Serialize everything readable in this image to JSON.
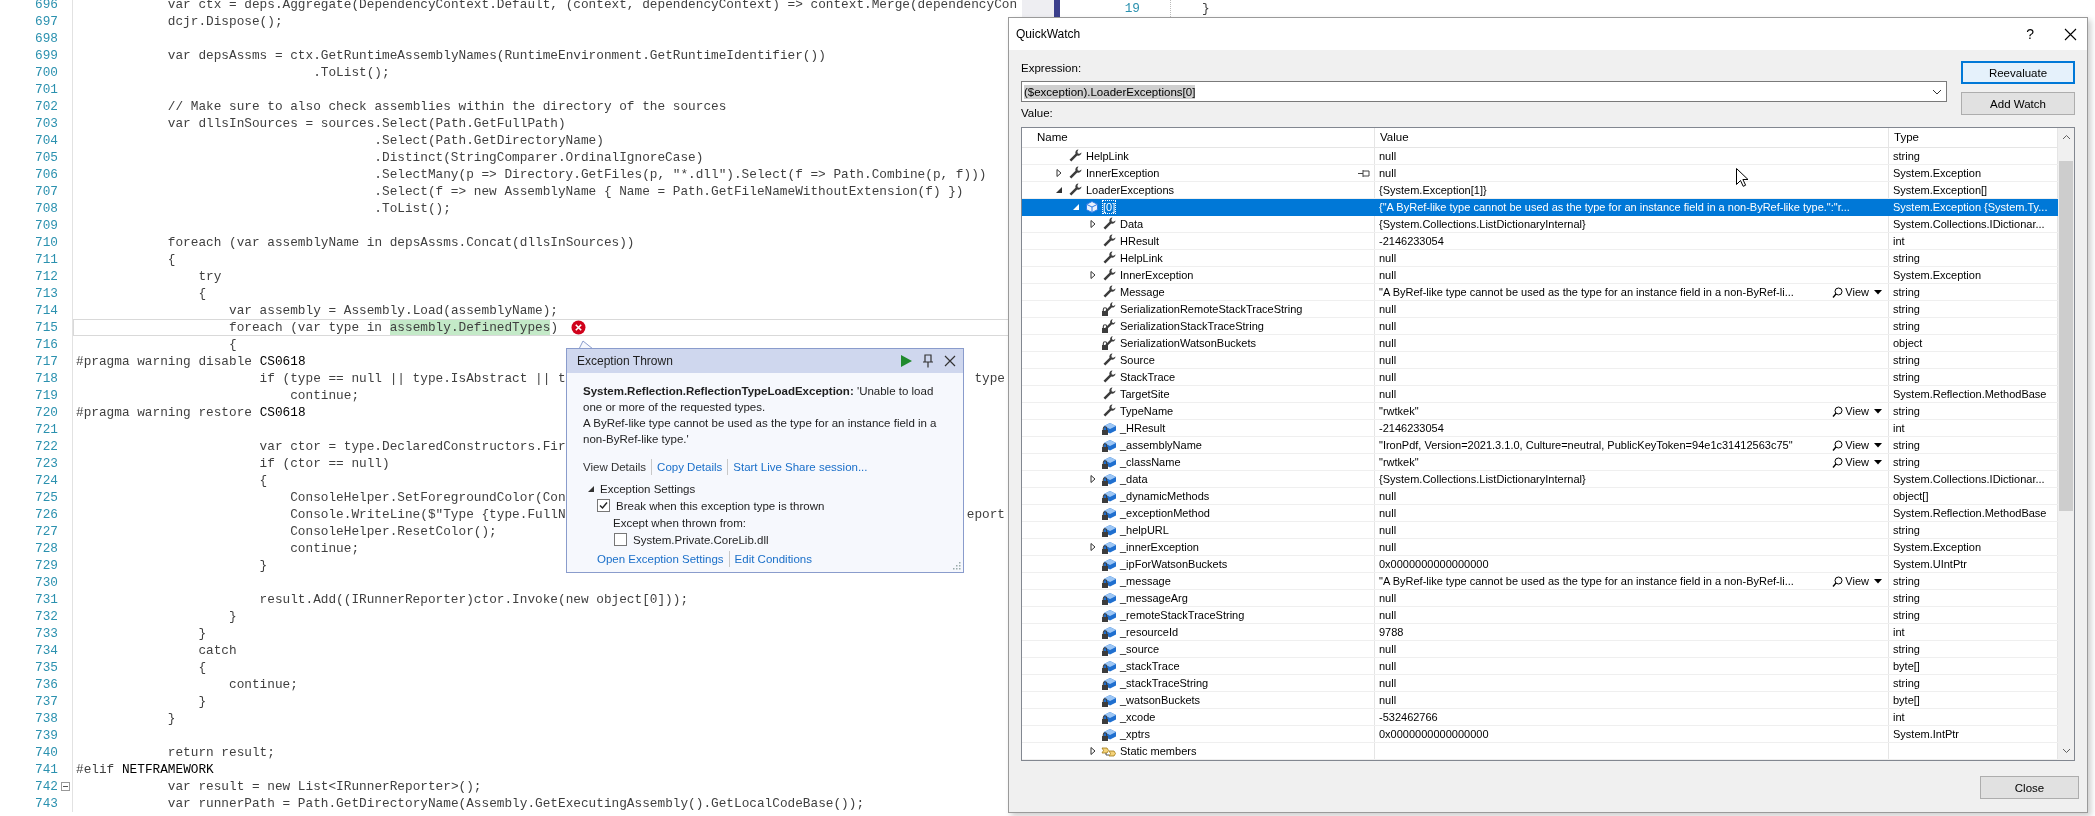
{
  "editor": {
    "lines": [
      {
        "number": "696",
        "text": "            var ctx = deps.Aggregate(DependencyContext.Default, (context, dependencyContext) => context.Merge(dependencyCon"
      },
      {
        "number": "697",
        "text": "            dcjr.Dispose();"
      },
      {
        "number": "698"
      },
      {
        "number": "699",
        "text": "            var depsAssms = ctx.GetRuntimeAssemblyNames(RuntimeEnvironment.GetRuntimeIdentifier())"
      },
      {
        "number": "700",
        "text": "                               .ToList();"
      },
      {
        "number": "701"
      },
      {
        "number": "702",
        "text": "            // Make sure to also check assemblies within the directory of the sources"
      },
      {
        "number": "703",
        "text": "            var dllsInSources = sources.Select(Path.GetFullPath)"
      },
      {
        "number": "704",
        "text": "                                       .Select(Path.GetDirectoryName)"
      },
      {
        "number": "705",
        "text": "                                       .Distinct(StringComparer.OrdinalIgnoreCase)"
      },
      {
        "number": "706",
        "text": "                                       .SelectMany(p => Directory.GetFiles(p, \"*.dll\").Select(f => Path.Combine(p, f)))"
      },
      {
        "number": "707",
        "text": "                                       .Select(f => new AssemblyName { Name = Path.GetFileNameWithoutExtension(f) })"
      },
      {
        "number": "708",
        "text": "                                       .ToList();"
      },
      {
        "number": "709"
      },
      {
        "number": "710",
        "text": "            foreach (var assemblyName in depsAssms.Concat(dllsInSources))"
      },
      {
        "number": "711",
        "text": "            {"
      },
      {
        "number": "712",
        "text": "                try"
      },
      {
        "number": "713",
        "text": "                {"
      },
      {
        "number": "714",
        "text": "                    var assembly = Assembly.Load(assemblyName);"
      },
      {
        "number": "715",
        "text": "                    foreach (var type in ",
        "highlight": "assembly.DefinedTypes",
        "after": ")",
        "error": true,
        "current": true
      },
      {
        "number": "716",
        "text": "                    {"
      },
      {
        "number": "717",
        "text": "#pragma warning disable ",
        "symbol": "CS0618"
      },
      {
        "number": "718",
        "text": "                        if (type == null || type.IsAbstract || t",
        "tail": "type"
      },
      {
        "number": "719",
        "text": "                            continue;"
      },
      {
        "number": "720",
        "text": "#pragma warning restore ",
        "symbol": "CS0618"
      },
      {
        "number": "721"
      },
      {
        "number": "722",
        "text": "                        var ctor = type.DeclaredConstructors.Fir"
      },
      {
        "number": "723",
        "text": "                        if (ctor == null)"
      },
      {
        "number": "724",
        "text": "                        {"
      },
      {
        "number": "725",
        "text": "                            ConsoleHelper.SetForegroundColor(Con"
      },
      {
        "number": "726",
        "text": "                            Console.WriteLine($\"Type {type.FullN",
        "tail": "eport"
      },
      {
        "number": "727",
        "text": "                            ConsoleHelper.ResetColor();"
      },
      {
        "number": "728",
        "text": "                            continue;"
      },
      {
        "number": "729",
        "text": "                        }"
      },
      {
        "number": "730"
      },
      {
        "number": "731",
        "text": "                        result.Add((IRunnerReporter)ctor.Invoke(new object[0]));"
      },
      {
        "number": "732",
        "text": "                    }"
      },
      {
        "number": "733",
        "text": "                }"
      },
      {
        "number": "734",
        "text": "                catch"
      },
      {
        "number": "735",
        "text": "                {"
      },
      {
        "number": "736",
        "text": "                    continue;"
      },
      {
        "number": "737",
        "text": "                }"
      },
      {
        "number": "738",
        "text": "            }"
      },
      {
        "number": "739"
      },
      {
        "number": "740",
        "text": "            return result;"
      },
      {
        "number": "741",
        "text": "#elif ",
        "symbol": "NETFRAMEWORK"
      },
      {
        "number": "742",
        "text": "            var result = new List<IRunnerReporter>();",
        "collapsible": true
      },
      {
        "number": "743",
        "text": "            var runnerPath = Path.GetDirectoryName(Assembly.GetExecutingAssembly().GetLocalCodeBase());"
      }
    ]
  },
  "split_editor": {
    "line_number": "19",
    "text": "}"
  },
  "exception_popup": {
    "title": "Exception Thrown",
    "message": "**System.Reflection.ReflectionTypeLoadException:** 'Unable to load one or more of the requested types.\nA ByRef-like type cannot be used as the type for an instance field in a non-ByRef-like type.'",
    "links": [
      {
        "label": "View Details",
        "kind": "plain"
      },
      {
        "label": "Copy Details",
        "kind": "link"
      },
      {
        "label": "Start Live Share session...",
        "kind": "link"
      }
    ],
    "settings": {
      "title": "Exception Settings",
      "expanded": true,
      "break_label": "Break when this exception type is thrown",
      "break_checked": true,
      "except_label": "Except when thrown from:",
      "modules": [
        {
          "label": "System.Private.CoreLib.dll",
          "checked": false
        }
      ]
    },
    "footer_links": [
      "Open Exception Settings",
      "Edit Conditions"
    ]
  },
  "quickwatch": {
    "title": "QuickWatch",
    "help": "?",
    "expression_label": "Expression:",
    "expression": "($exception).LoaderExceptions[0]",
    "expression_selected": true,
    "buttons": [
      {
        "label": "Reevaluate",
        "default": true
      },
      {
        "label": "Add Watch",
        "default": false
      }
    ],
    "value_label": "Value:",
    "columns": [
      "Name",
      "Value",
      "Type"
    ],
    "rows": [
      {
        "name": "HelpLink",
        "kind": "property",
        "value": "null",
        "type": "string",
        "selected": false
      },
      {
        "name": "InnerException",
        "kind": "property",
        "expanded": false,
        "pin_icon": true,
        "value": "null",
        "type": "System.Exception",
        "selected": false
      },
      {
        "name": "LoaderExceptions",
        "kind": "property",
        "expanded": true,
        "value": "{System.Exception[1]}",
        "type": "System.Exception[]",
        "selected": false,
        "children": [
          {
            "name": "[0]",
            "kind": "instance",
            "expanded": true,
            "value": "{\"A ByRef-like type cannot be used as the type for an instance field in a non-ByRef-like type.\":\"r...",
            "type": "System.Exception {System.Ty...",
            "selected": true,
            "children": [
              {
                "name": "Data",
                "kind": "property",
                "expanded": false,
                "value": "{System.Collections.ListDictionaryInternal}",
                "type": "System.Collections.IDictionar...",
                "selected": false
              },
              {
                "name": "HResult",
                "kind": "property",
                "value": "-2146233054",
                "type": "int",
                "selected": false
              },
              {
                "name": "HelpLink",
                "kind": "property",
                "value": "null",
                "type": "string",
                "selected": false
              },
              {
                "name": "InnerException",
                "kind": "property",
                "expanded": false,
                "value": "null",
                "type": "System.Exception",
                "selected": false
              },
              {
                "name": "Message",
                "kind": "property",
                "value": "\"A ByRef-like type cannot be used as the type for an instance field in a non-ByRef-li...",
                "view": "View",
                "type": "string",
                "selected": false
              },
              {
                "name": "SerializationRemoteStackTraceString",
                "kind": "private-property",
                "value": "null",
                "type": "string",
                "selected": false
              },
              {
                "name": "SerializationStackTraceString",
                "kind": "private-property",
                "value": "null",
                "type": "string",
                "selected": false
              },
              {
                "name": "SerializationWatsonBuckets",
                "kind": "private-property",
                "value": "null",
                "type": "object",
                "selected": false
              },
              {
                "name": "Source",
                "kind": "property",
                "value": "null",
                "type": "string",
                "selected": false
              },
              {
                "name": "StackTrace",
                "kind": "property",
                "value": "null",
                "type": "string",
                "selected": false
              },
              {
                "name": "TargetSite",
                "kind": "property",
                "value": "null",
                "type": "System.Reflection.MethodBase",
                "selected": false
              },
              {
                "name": "TypeName",
                "kind": "property",
                "value": "\"rwtkek\"",
                "view": "View",
                "type": "string",
                "selected": false
              },
              {
                "name": "_HResult",
                "kind": "field",
                "value": "-2146233054",
                "type": "int",
                "selected": false
              },
              {
                "name": "_assemblyName",
                "kind": "field",
                "value": "\"IronPdf, Version=2021.3.1.0, Culture=neutral, PublicKeyToken=94e1c31412563c75\"",
                "view": "View",
                "type": "string",
                "selected": false
              },
              {
                "name": "_className",
                "kind": "field",
                "value": "\"rwtkek\"",
                "view": "View",
                "type": "string",
                "selected": false
              },
              {
                "name": "_data",
                "kind": "field",
                "expanded": false,
                "value": "{System.Collections.ListDictionaryInternal}",
                "type": "System.Collections.IDictionar...",
                "selected": false
              },
              {
                "name": "_dynamicMethods",
                "kind": "field",
                "value": "null",
                "type": "object[]",
                "selected": false
              },
              {
                "name": "_exceptionMethod",
                "kind": "field",
                "value": "null",
                "type": "System.Reflection.MethodBase",
                "selected": false
              },
              {
                "name": "_helpURL",
                "kind": "field",
                "value": "null",
                "type": "string",
                "selected": false
              },
              {
                "name": "_innerException",
                "kind": "field",
                "expanded": false,
                "value": "null",
                "type": "System.Exception",
                "selected": false
              },
              {
                "name": "_ipForWatsonBuckets",
                "kind": "field",
                "value": "0x0000000000000000",
                "type": "System.UIntPtr",
                "selected": false
              },
              {
                "name": "_message",
                "kind": "field",
                "value": "\"A ByRef-like type cannot be used as the type for an instance field in a non-ByRef-li...",
                "view": "View",
                "type": "string",
                "selected": false
              },
              {
                "name": "_messageArg",
                "kind": "field",
                "value": "null",
                "type": "string",
                "selected": false
              },
              {
                "name": "_remoteStackTraceString",
                "kind": "field",
                "value": "null",
                "type": "string",
                "selected": false
              },
              {
                "name": "_resourceId",
                "kind": "field",
                "value": "9788",
                "type": "int",
                "selected": false
              },
              {
                "name": "_source",
                "kind": "field",
                "value": "null",
                "type": "string",
                "selected": false
              },
              {
                "name": "_stackTrace",
                "kind": "field",
                "value": "null",
                "type": "byte[]",
                "selected": false
              },
              {
                "name": "_stackTraceString",
                "kind": "field",
                "value": "null",
                "type": "string",
                "selected": false
              },
              {
                "name": "_watsonBuckets",
                "kind": "field",
                "value": "null",
                "type": "byte[]",
                "selected": false
              },
              {
                "name": "_xcode",
                "kind": "field",
                "value": "-532462766",
                "type": "int",
                "selected": false
              },
              {
                "name": "_xptrs",
                "kind": "field",
                "value": "0x0000000000000000",
                "type": "System.IntPtr",
                "selected": false
              },
              {
                "name": "Static members",
                "kind": "static",
                "expanded": false,
                "selected": false
              }
            ]
          }
        ]
      }
    ],
    "close": "Close"
  }
}
